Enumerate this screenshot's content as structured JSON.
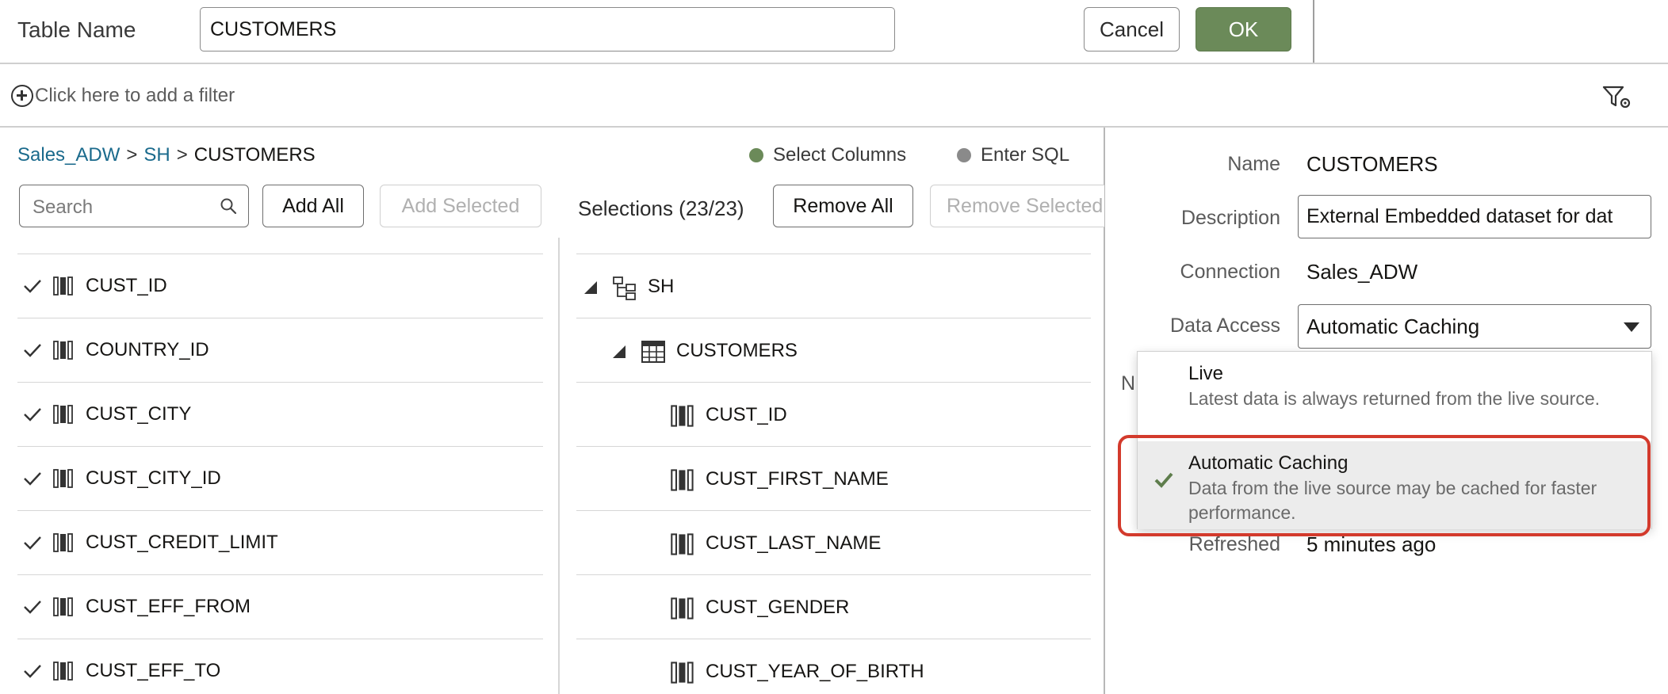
{
  "header": {
    "table_name_label": "Table Name",
    "table_name_value": "CUSTOMERS",
    "cancel_label": "Cancel",
    "ok_label": "OK"
  },
  "filter": {
    "placeholder": "Click here to add a filter",
    "icon": "filter-settings-icon"
  },
  "breadcrumb": {
    "items": [
      "Sales_ADW",
      "SH",
      "CUSTOMERS"
    ],
    "separator": ">"
  },
  "mode": {
    "select_columns": "Select Columns",
    "enter_sql": "Enter SQL",
    "selected_color": "#6b8a59",
    "unselected_color": "#8a8a8a"
  },
  "source": {
    "search_placeholder": "Search",
    "add_all": "Add All",
    "add_selected": "Add Selected",
    "columns": [
      "CUST_ID",
      "COUNTRY_ID",
      "CUST_CITY",
      "CUST_CITY_ID",
      "CUST_CREDIT_LIMIT",
      "CUST_EFF_FROM",
      "CUST_EFF_TO"
    ]
  },
  "selections": {
    "label": "Selections (23/23)",
    "remove_all": "Remove All",
    "remove_selected": "Remove Selected",
    "schema": "SH",
    "table": "CUSTOMERS",
    "columns": [
      "CUST_ID",
      "CUST_FIRST_NAME",
      "CUST_LAST_NAME",
      "CUST_GENDER",
      "CUST_YEAR_OF_BIRTH"
    ]
  },
  "properties": {
    "name_label": "Name",
    "name_value": "CUSTOMERS",
    "description_label": "Description",
    "description_value": "External Embedded dataset for dat",
    "connection_label": "Connection",
    "connection_value": "Sales_ADW",
    "data_access_label": "Data Access",
    "data_access_value": "Automatic Caching",
    "partial_label": "N",
    "refreshed_label": "Refreshed",
    "refreshed_value": "5 minutes ago"
  },
  "dropdown": {
    "options": [
      {
        "title": "Live",
        "description": "Latest data is always returned from the live source."
      },
      {
        "title": "Automatic Caching",
        "description": "Data from the live source may be cached for faster performance."
      }
    ],
    "selected_index": 1,
    "check_color": "#5e7d4c",
    "highlight_color": "#d33a2c"
  }
}
